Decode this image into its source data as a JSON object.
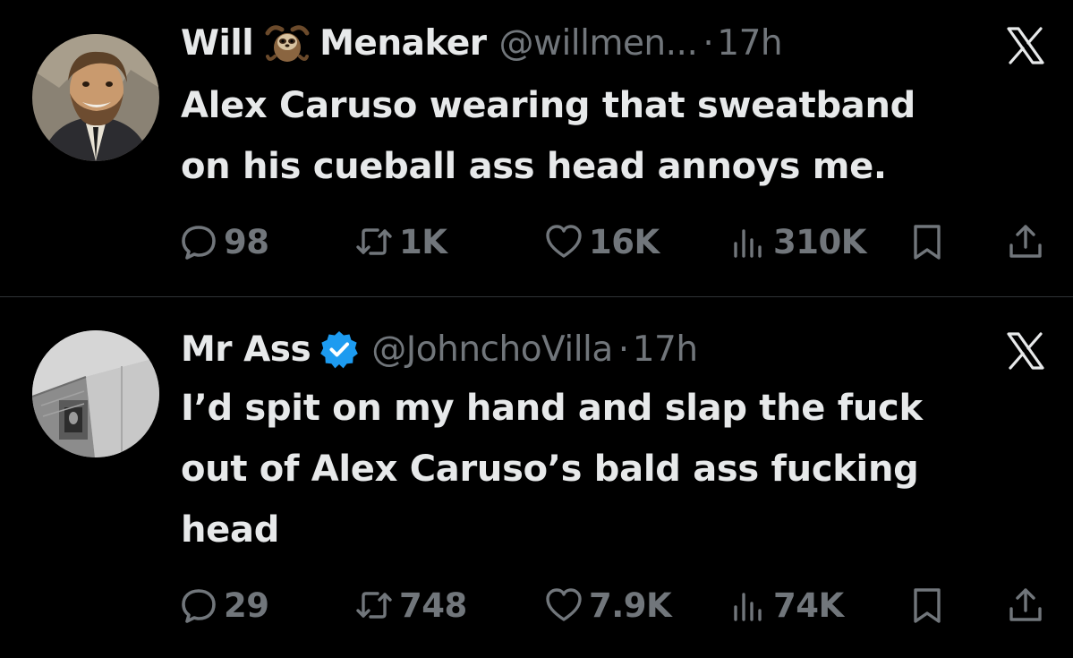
{
  "colors": {
    "background": "#000000",
    "text": "#e7e9ea",
    "muted": "#71767b",
    "verified": "#1d9bf0",
    "divider": "#2f3336"
  },
  "tweets": [
    {
      "name_part1": "Will",
      "name_emoji": "sloth-emoji",
      "name_part2": "Menaker",
      "handle": "@willmen...",
      "separator": "·",
      "time": "17h",
      "text_lines": [
        "Alex Caruso wearing that sweatband",
        "on his cueball ass head annoys me."
      ],
      "replies": "98",
      "reposts": "1K",
      "likes": "16K",
      "views": "310K"
    },
    {
      "name": "Mr Ass",
      "verified": true,
      "handle": "@JohnchoVilla",
      "separator": "·",
      "time": "17h",
      "text_lines": [
        "I’d spit on my hand and slap the fuck",
        "out of Alex Caruso’s bald ass fucking",
        "head"
      ],
      "replies": "29",
      "reposts": "748",
      "likes": "7.9K",
      "views": "74K"
    }
  ]
}
